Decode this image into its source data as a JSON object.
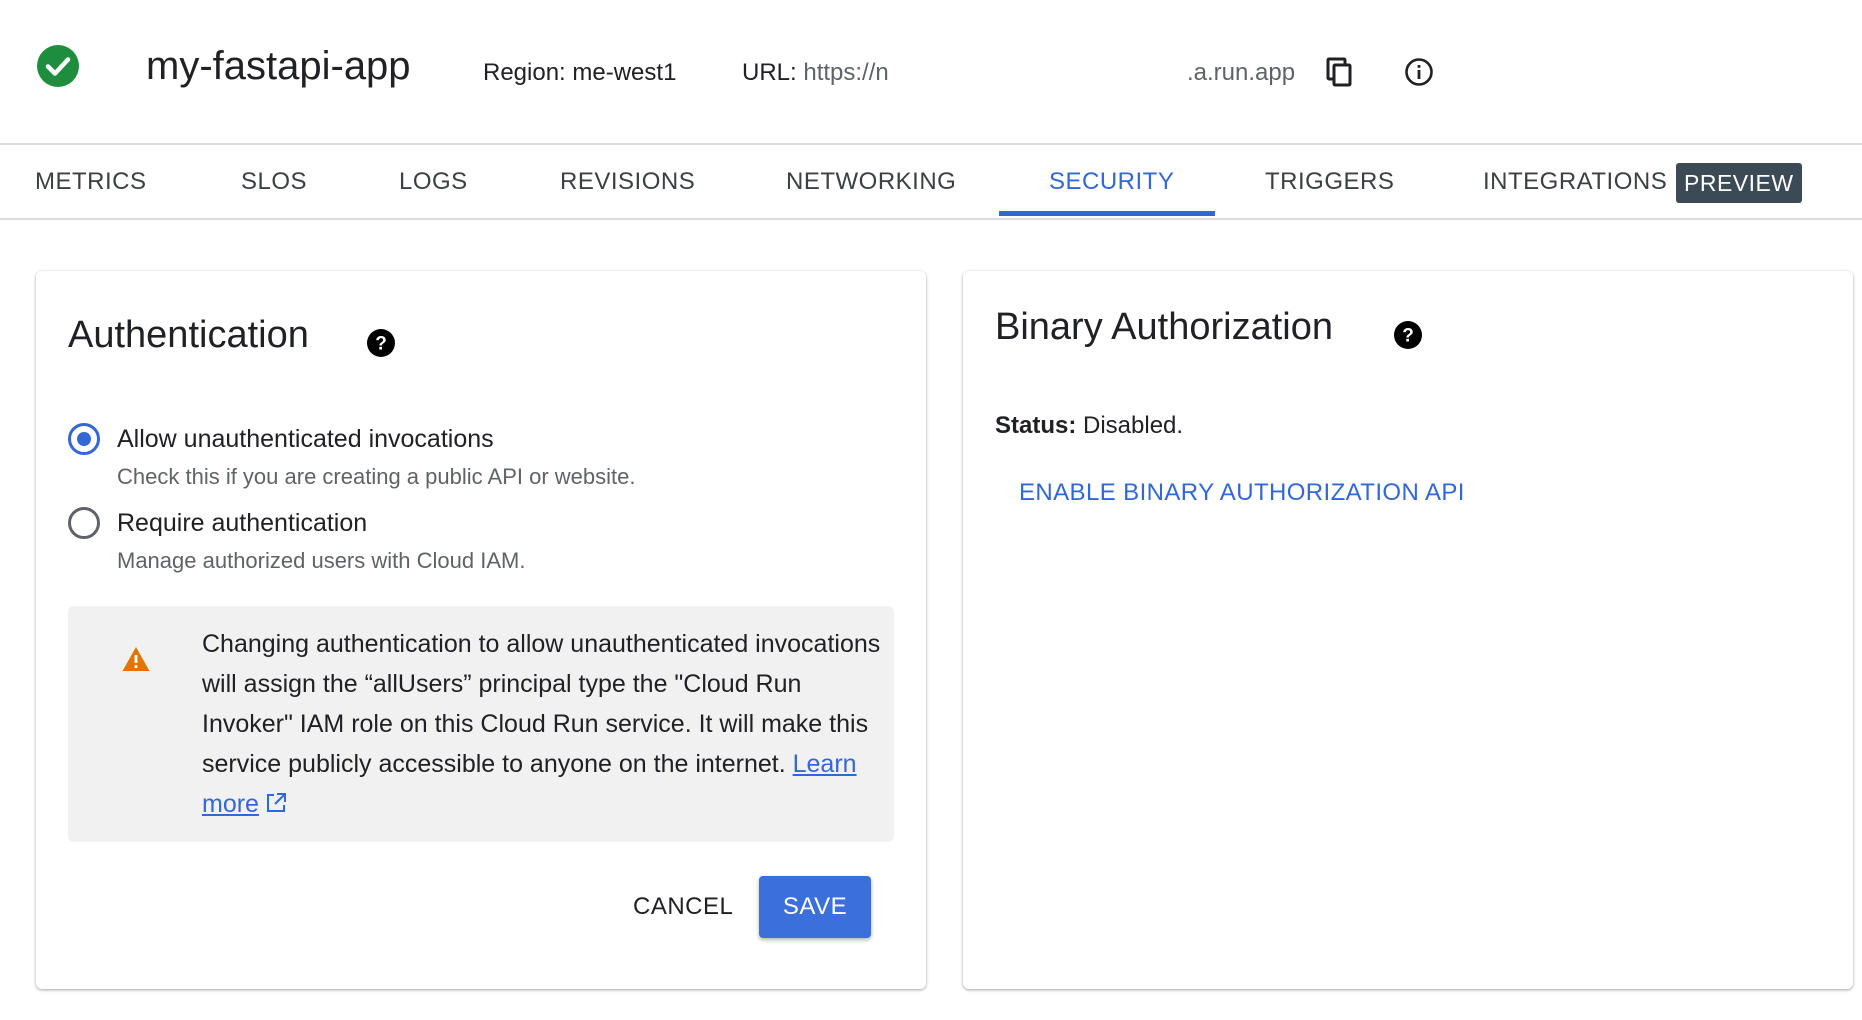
{
  "header": {
    "service_name": "my-fastapi-app",
    "region": "Region: me-west1",
    "url_label": "URL:",
    "url_start": "https://n",
    "url_end": ".a.run.app",
    "status_icon": "check-circle-icon",
    "copy_icon": "copy-icon",
    "info_icon": "info-icon"
  },
  "tabs": [
    {
      "label": "METRICS"
    },
    {
      "label": "SLOS"
    },
    {
      "label": "LOGS"
    },
    {
      "label": "REVISIONS"
    },
    {
      "label": "NETWORKING"
    },
    {
      "label": "SECURITY",
      "active": true
    },
    {
      "label": "TRIGGERS"
    },
    {
      "label": "INTEGRATIONS",
      "badge": "PREVIEW"
    }
  ],
  "authentication": {
    "title": "Authentication",
    "options": [
      {
        "label": "Allow unauthenticated invocations",
        "description": "Check this if you are creating a public API or website.",
        "selected": true
      },
      {
        "label": "Require authentication",
        "description": "Manage authorized users with Cloud IAM.",
        "selected": false
      }
    ],
    "warning": {
      "text": "Changing authentication to allow unauthenticated invocations will assign the “allUsers” principal type the \"Cloud Run Invoker\" IAM role on this Cloud Run service. It will make this service publicly accessible to anyone on the internet.",
      "link": "Learn more"
    },
    "cancel_label": "CANCEL",
    "save_label": "SAVE"
  },
  "binary_authorization": {
    "title": "Binary Authorization",
    "status_label": "Status:",
    "status_value": "Disabled.",
    "enable_link": "ENABLE BINARY AUTHORIZATION API"
  },
  "colors": {
    "accent": "#3367d6",
    "success": "#1e8e3e",
    "warning": "#e37400",
    "badge_bg": "#3c4a56"
  }
}
